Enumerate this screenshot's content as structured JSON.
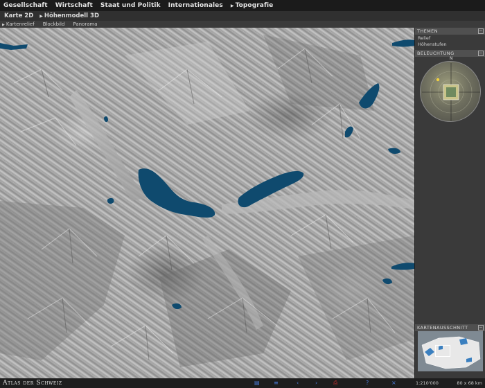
{
  "menu": {
    "items": [
      "Gesellschaft",
      "Wirtschaft",
      "Staat und Politik",
      "Internationales",
      "Topografie"
    ]
  },
  "submenu": {
    "items": [
      "Karte 2D",
      "Höhenmodell 3D"
    ]
  },
  "viewmodes": {
    "items": [
      "Kartenrelief",
      "Blockbild",
      "Panorama"
    ]
  },
  "panel": {
    "themen_title": "THEMEN",
    "themen_items": [
      "Relief",
      "Höhenstufen"
    ],
    "beleuchtung_title": "BELEUCHTUNG",
    "north_label": "N",
    "kartenausschnitt_title": "KARTENAUSSCHNITT"
  },
  "footer": {
    "logo": "Atlas der Schweiz",
    "scale": "1:210'000",
    "dims": "80 x 68 km"
  },
  "colors": {
    "lake": "#0f4a6e",
    "accent": "#4b7bd8"
  }
}
